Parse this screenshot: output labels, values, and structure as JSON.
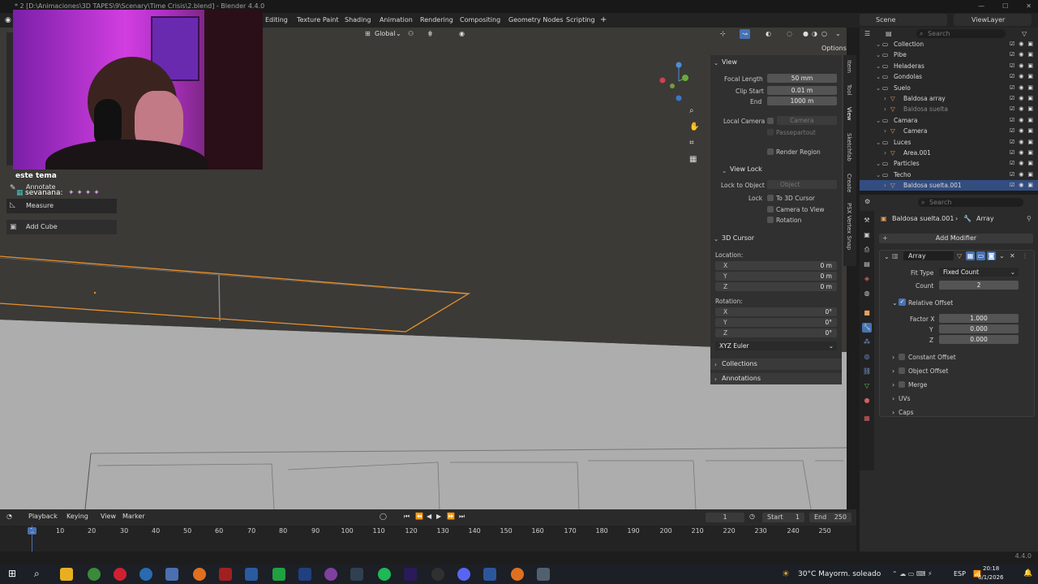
{
  "window": {
    "title": "* 2 [D:\\Animaciones\\3D TAPES\\9\\Scenary\\Time Crisis\\2.blend] - Blender 4.4.0"
  },
  "workspaces": [
    "Editing",
    "Texture Paint",
    "Shading",
    "Animation",
    "Rendering",
    "Compositing",
    "Geometry Nodes",
    "Scripting"
  ],
  "add_tab": "+",
  "scene": {
    "label": "Scene"
  },
  "view_layer": {
    "label": "ViewLayer"
  },
  "viewport_header": {
    "transform_orientation": "Global",
    "options_label": "Options"
  },
  "chat": {
    "line1": "este tema",
    "user": "sevanana:"
  },
  "toolbar": {
    "annotate": "Annotate",
    "measure": "Measure",
    "add_cube": "Add Cube"
  },
  "npanel": {
    "view_title": "View",
    "focal_length_label": "Focal Length",
    "focal_length": "50 mm",
    "clip_start_label": "Clip Start",
    "clip_start": "0.01 m",
    "end_label": "End",
    "end": "1000 m",
    "local_camera_label": "Local Camera",
    "camera_placeholder": "Camera",
    "passepartout": "Passepartout",
    "render_region": "Render Region",
    "view_lock_title": "View Lock",
    "lock_to_object_label": "Lock to Object",
    "object_placeholder": "Object",
    "lock_label": "Lock",
    "to_3d_cursor": "To 3D Cursor",
    "camera_to_view": "Camera to View",
    "rotation_opt": "Rotation",
    "cursor_title": "3D Cursor",
    "location_label": "Location:",
    "loc_x_label": "X",
    "loc_x": "0 m",
    "loc_y_label": "Y",
    "loc_y": "0 m",
    "loc_z_label": "Z",
    "loc_z": "0 m",
    "rotation_label": "Rotation:",
    "rot_x_label": "X",
    "rot_x": "0°",
    "rot_y_label": "Y",
    "rot_y": "0°",
    "rot_z_label": "Z",
    "rot_z": "0°",
    "rotation_mode": "XYZ Euler",
    "collections": "Collections",
    "annotations": "Annotations"
  },
  "ntabs": [
    "Item",
    "Tool",
    "View",
    "Sketchfab",
    "Create",
    "PSX Vertex Snap"
  ],
  "outliner": {
    "search_placeholder": "Search",
    "rows": [
      {
        "name": "Collection",
        "indent": 1,
        "selected": false
      },
      {
        "name": "Pibe",
        "indent": 1,
        "selected": false
      },
      {
        "name": "Heladeras",
        "indent": 1,
        "selected": false
      },
      {
        "name": "Gondolas",
        "indent": 1,
        "selected": false
      },
      {
        "name": "Suelo",
        "indent": 1,
        "selected": false
      },
      {
        "name": "Baldosa array",
        "indent": 2,
        "selected": false
      },
      {
        "name": "Baldosa suelta",
        "indent": 2,
        "selected": false
      },
      {
        "name": "Camara",
        "indent": 1,
        "selected": false
      },
      {
        "name": "Camera",
        "indent": 2,
        "selected": false
      },
      {
        "name": "Luces",
        "indent": 1,
        "selected": false
      },
      {
        "name": "Area.001",
        "indent": 2,
        "selected": false
      },
      {
        "name": "Particles",
        "indent": 1,
        "selected": false
      },
      {
        "name": "Techo",
        "indent": 1,
        "selected": false
      },
      {
        "name": "Baldosa suelta.001",
        "indent": 2,
        "selected": true
      }
    ]
  },
  "properties": {
    "search_placeholder": "Search",
    "breadcrumb_object": "Baldosa suelta.001",
    "breadcrumb_modifier": "Array",
    "add_modifier": "Add Modifier",
    "modifier_name": "Array",
    "fit_type_label": "Fit Type",
    "fit_type": "Fixed Count",
    "count_label": "Count",
    "count": "2",
    "relative_offset": "Relative Offset",
    "factor_x_label": "Factor X",
    "factor_x": "1.000",
    "factor_y_label": "Y",
    "factor_y": "0.000",
    "factor_z_label": "Z",
    "factor_z": "0.000",
    "constant_offset": "Constant Offset",
    "object_offset": "Object Offset",
    "merge": "Merge",
    "uvs": "UVs",
    "caps": "Caps"
  },
  "timeline": {
    "playback": "Playback",
    "keying": "Keying",
    "view": "View",
    "marker": "Marker",
    "current_frame": "1",
    "start_label": "Start",
    "start": "1",
    "end_label": "End",
    "end": "250",
    "ticks": [
      "1",
      "10",
      "20",
      "30",
      "40",
      "50",
      "60",
      "70",
      "80",
      "90",
      "100",
      "110",
      "120",
      "130",
      "140",
      "150",
      "160",
      "170",
      "180",
      "190",
      "200",
      "210",
      "220",
      "230",
      "240",
      "250"
    ]
  },
  "status": {
    "version": "4.4.0"
  },
  "taskbar": {
    "weather": "30°C  Mayorm. soleado",
    "lang": "ESP",
    "time": "20:18",
    "date": "6/1/2026"
  },
  "colors": {
    "selected_outline": "#e8902a",
    "accent_blue": "#4772b3",
    "panel": "#303030"
  }
}
